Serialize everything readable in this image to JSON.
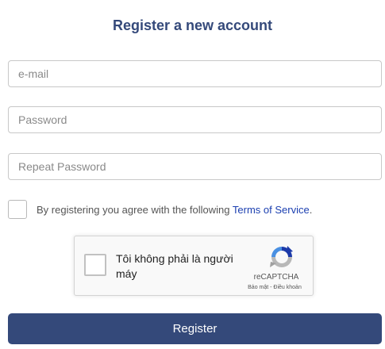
{
  "form": {
    "title": "Register a new account",
    "email_placeholder": "e-mail",
    "password_placeholder": "Password",
    "repeat_password_placeholder": "Repeat Password",
    "agree_text": "By registering you agree with the following ",
    "terms_link": "Terms of Service",
    "agree_suffix": ".",
    "register_label": "Register"
  },
  "recaptcha": {
    "label": "Tôi không phải là người máy",
    "brand": "reCAPTCHA",
    "links": "Bảo mật - Điều khoản",
    "icon": "recaptcha-logo-icon"
  },
  "colors": {
    "primary": "#34497a",
    "link": "#1b3fb0"
  }
}
